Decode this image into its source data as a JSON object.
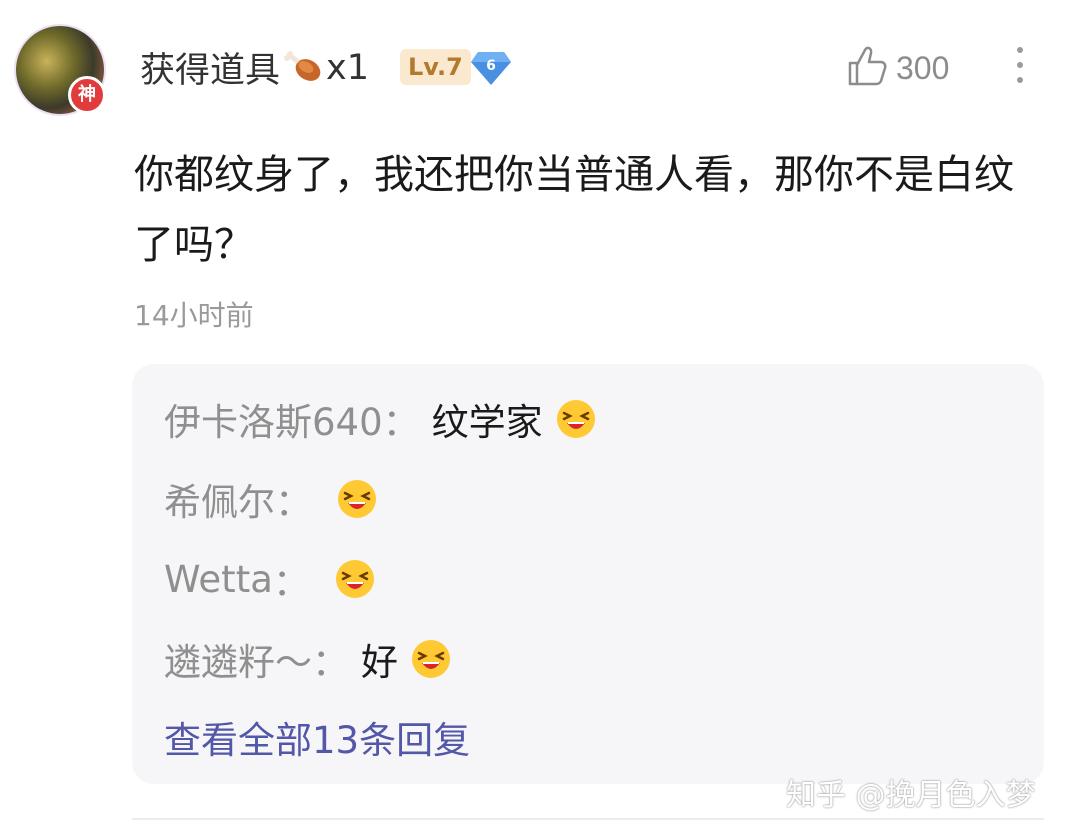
{
  "comment": {
    "author": "获得道具",
    "item_multiplier": "x1",
    "level": "Lv.7",
    "gem_level": "6",
    "avatar_badge": "神",
    "likes": "300",
    "text": "你都纹身了，我还把你当普通人看，那你不是白纹了吗？",
    "time": "14小时前"
  },
  "replies": [
    {
      "name": "伊卡洛斯640",
      "sep": "：",
      "text": "纹学家"
    },
    {
      "name": "希佩尔",
      "sep": "：",
      "text": ""
    },
    {
      "name": "Wetta",
      "sep": "：",
      "text": ""
    },
    {
      "name": "遴遴籽～",
      "sep": "：",
      "text": "好"
    }
  ],
  "view_all": "查看全部13条回复",
  "watermark": "知乎 @挽月色入梦",
  "colors": {
    "link": "#5257a8",
    "level_bg": "#fbe9cf",
    "level_fg": "#b37a2f",
    "gem": "#4a90e2"
  },
  "icons": [
    "drumstick-icon",
    "gem-icon",
    "thumbs-up-icon",
    "more-icon",
    "laughing-emoji-icon"
  ]
}
